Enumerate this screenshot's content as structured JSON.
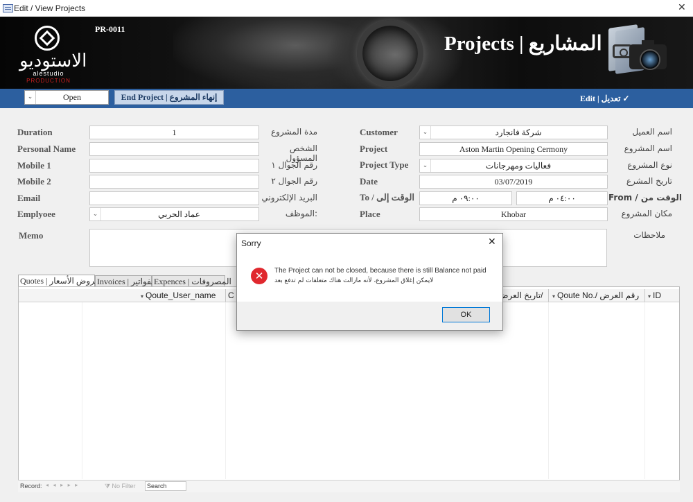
{
  "window": {
    "title": "Edit / View Projects",
    "close": "✕"
  },
  "header": {
    "project_code": "PR-0011",
    "title": "Projects | المشاريع",
    "logo_arabic": "الاستوديو",
    "logo_english": "alestudio",
    "logo_production": "PRODUCTION"
  },
  "toolbar": {
    "status_value": "Open",
    "end_project_label": "End Project | إنهاء المشروع",
    "mode_label": "Edit | تعديل ✓"
  },
  "form": {
    "left": [
      {
        "label": "Duration",
        "label_ar": "مدة المشروع",
        "value": "1",
        "type": "text"
      },
      {
        "label": "Personal Name",
        "label_ar": "الشخص المسؤول",
        "value": "",
        "type": "text"
      },
      {
        "label": "Mobile 1",
        "label_ar": "رقم الجوال ١",
        "value": "",
        "type": "text"
      },
      {
        "label": "Mobile 2",
        "label_ar": "رقم الجوال ٢",
        "value": "",
        "type": "text"
      },
      {
        "label": "Email",
        "label_ar": "البريد الإلكتروني",
        "value": "",
        "type": "text"
      },
      {
        "label": "Emplyoee",
        "label_ar": "الموظف:",
        "value": "عماد الحربي",
        "type": "combo"
      }
    ],
    "right": [
      {
        "label": "Customer",
        "label_ar": "اسم العميل",
        "value": "شركة فانجارد",
        "type": "combo"
      },
      {
        "label": "Project",
        "label_ar": "اسم المشروع",
        "value": "Aston Martin Opening Cermony",
        "type": "text"
      },
      {
        "label": "Project Type",
        "label_ar": "نوع المشروع",
        "value": "فعاليات ومهرجانات",
        "type": "combo"
      },
      {
        "label": "Date",
        "label_ar": "تاريخ المشرع",
        "value": "03/07/2019",
        "type": "text"
      },
      {
        "label": "To / الوقت إلى",
        "label_ar": "From / الوقت من",
        "value_to": "٠٩:٠٠ م",
        "value_from": "٠٤:٠٠ م",
        "type": "time"
      },
      {
        "label": "Place",
        "label_ar": "مكان المشروع",
        "value": "Khobar",
        "type": "text"
      }
    ],
    "memo_label": "Memo",
    "memo_label_ar": "ملاحظات",
    "memo_value": ""
  },
  "tabs": [
    {
      "label": "Quotes | عروض الأسعار",
      "active": true
    },
    {
      "label": "Invoices | الفواتير",
      "active": false
    },
    {
      "label": "Expences | المصروفات",
      "active": false
    }
  ],
  "grid": {
    "columns": [
      "Qoute_User_name",
      "C",
      "تاريخ العرض/",
      "Qoute No./ رقم العرض",
      "ID"
    ],
    "rows": []
  },
  "nav": {
    "record_label": "Record:",
    "arrows": "◂ ◂ ▸ ▸ ▸",
    "filter_label": "No Filter",
    "search_placeholder": "Search"
  },
  "dialog": {
    "title": "Sorry",
    "close": "✕",
    "message_en": "The Project can not be closed, because there is still Balance not paid",
    "message_ar": "لايمكن إغلاق المشروع، لأنه مازالت هناك متعلقات لم تدفع بعد",
    "ok_label": "OK",
    "error_glyph": "✕"
  }
}
